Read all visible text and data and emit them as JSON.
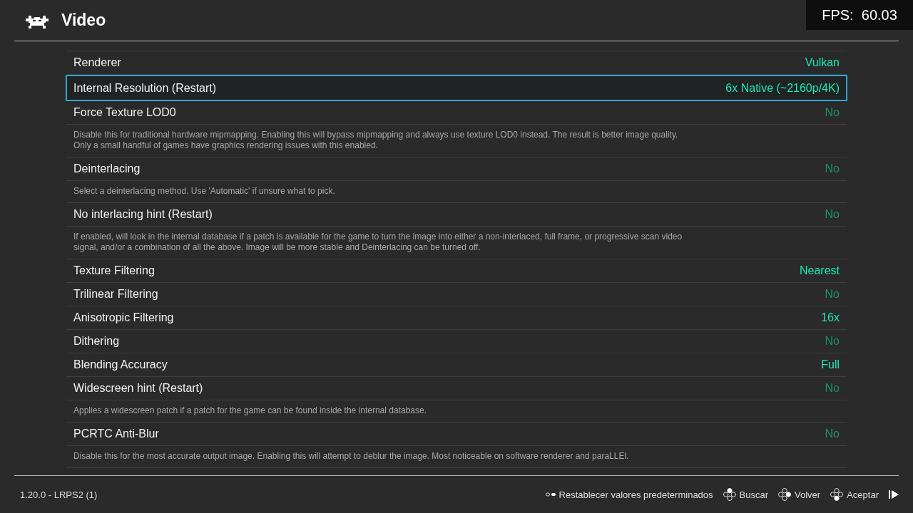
{
  "header": {
    "title": "Video"
  },
  "fps": "FPS:  60.03",
  "settings": [
    {
      "label": "Renderer",
      "value": "Vulkan",
      "on": true,
      "selected": false
    },
    {
      "label": "Internal Resolution (Restart)",
      "value": "6x Native (~2160p/4K)",
      "on": true,
      "selected": true
    },
    {
      "label": "Force Texture LOD0",
      "value": "No",
      "on": false,
      "selected": false,
      "description": "Disable this for traditional hardware mipmapping. Enabling this will bypass mipmapping and always use texture LOD0 instead. The result is better image quality. Only a small handful of games have graphics rendering issues with this enabled."
    },
    {
      "label": "Deinterlacing",
      "value": "No",
      "on": false,
      "selected": false,
      "description": "Select a deinterlacing method. Use 'Automatic' if unsure what to pick."
    },
    {
      "label": "No interlacing hint (Restart)",
      "value": "No",
      "on": false,
      "selected": false,
      "description": "If enabled, will look in the internal database if a patch is available for the game to turn the image into either a non-interlaced, full frame, or progressive scan video signal, and/or a combination of all the above. Image will be more stable and Deinterlacing can be turned off."
    },
    {
      "label": "Texture Filtering",
      "value": "Nearest",
      "on": true,
      "selected": false
    },
    {
      "label": "Trilinear Filtering",
      "value": "No",
      "on": false,
      "selected": false
    },
    {
      "label": "Anisotropic Filtering",
      "value": "16x",
      "on": true,
      "selected": false
    },
    {
      "label": "Dithering",
      "value": "No",
      "on": false,
      "selected": false
    },
    {
      "label": "Blending Accuracy",
      "value": "Full",
      "on": true,
      "selected": false
    },
    {
      "label": "Widescreen hint (Restart)",
      "value": "No",
      "on": false,
      "selected": false,
      "description": "Applies a widescreen patch if a patch for the game can be found inside the internal database."
    },
    {
      "label": "PCRTC Anti-Blur",
      "value": "No",
      "on": false,
      "selected": false,
      "description": "Disable this for the most accurate output image. Enabling this will attempt to deblur the image. Most noticeable on software renderer and paraLLEl."
    }
  ],
  "footer": {
    "version": "1.20.0 - LRPS2 (1)",
    "hints": [
      {
        "kind": "select",
        "label": "Restablecer valores predeterminados"
      },
      {
        "kind": "top",
        "label": "Buscar"
      },
      {
        "kind": "right",
        "label": "Volver"
      },
      {
        "kind": "bottom",
        "label": "Aceptar"
      },
      {
        "kind": "start"
      }
    ]
  }
}
